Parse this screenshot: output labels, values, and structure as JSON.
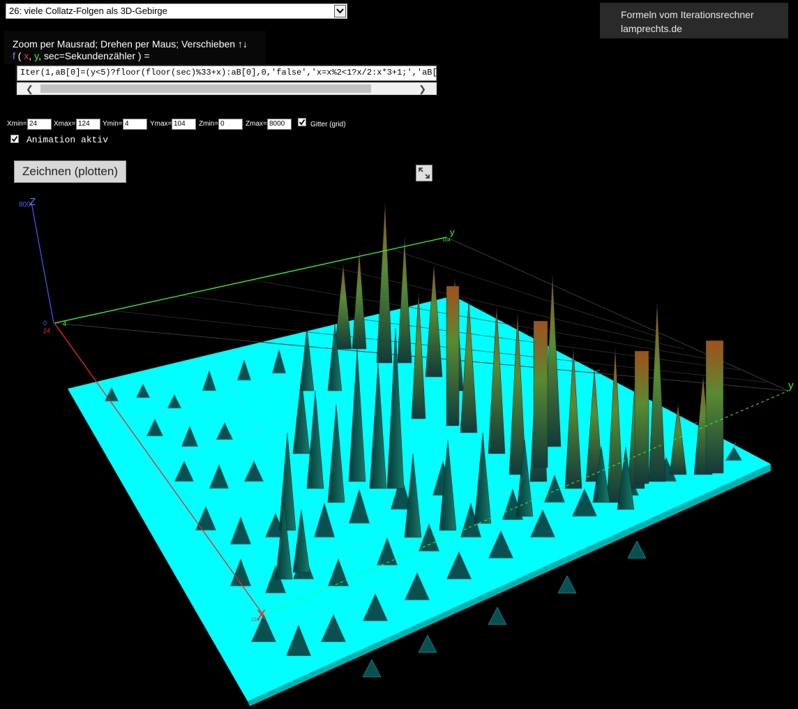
{
  "example_select": {
    "value": "26: viele Collatz-Folgen als 3D-Gebirge"
  },
  "brand": {
    "line1": "Formeln vom Iterationsrechner",
    "line2": "lamprechts.de"
  },
  "info": {
    "line1": "Zoom per Mausrad; Drehen per Maus; Verschieben ↑↓",
    "f": "f",
    "open": " ( ",
    "x": "x",
    "y": "y",
    "rest": ", sec=Sekundenzähler ) ="
  },
  "formula": {
    "value": "Iter(1,aB[0]=(y<5)?floor(floor(sec)%33+x):aB[0],0,'false','x=x%2<1?x/2:x*3+1;','aB["
  },
  "ranges": {
    "xmin_label": "Xmin=",
    "xmin": "24",
    "xmax_label": "Xmax=",
    "xmax": "124",
    "ymin_label": "Ymin=",
    "ymin": "4",
    "ymax_label": "Ymax=",
    "ymax": "104",
    "zmin_label": "Zmin=",
    "zmin": "0",
    "zmax_label": "Zmax=",
    "zmax": "8000"
  },
  "grid_checkbox": {
    "label": "Gitter (grid)",
    "checked": true
  },
  "animation_checkbox": {
    "label": "Animation aktiv",
    "checked": true
  },
  "plot_button": {
    "label": "Zeichnen (plotten)"
  },
  "icons": {
    "fullscreen": "fullscreen-toggle-icon",
    "select_arrow": "chevron-down-icon",
    "scroll_left": "chevron-left-icon",
    "scroll_right": "chevron-right-icon"
  },
  "axes": {
    "z_label": "Z",
    "z_max": "800",
    "z_min": "0",
    "x_label": "X",
    "x_min": "24",
    "x_max": "124",
    "y_label": "y",
    "y_min": "4",
    "y_end": "104"
  },
  "colors": {
    "surface": "#00ffff",
    "x_axis": "#ff2020",
    "y_axis": "#33ff33",
    "z_axis": "#5555ff",
    "peak_high": "#b04020"
  }
}
